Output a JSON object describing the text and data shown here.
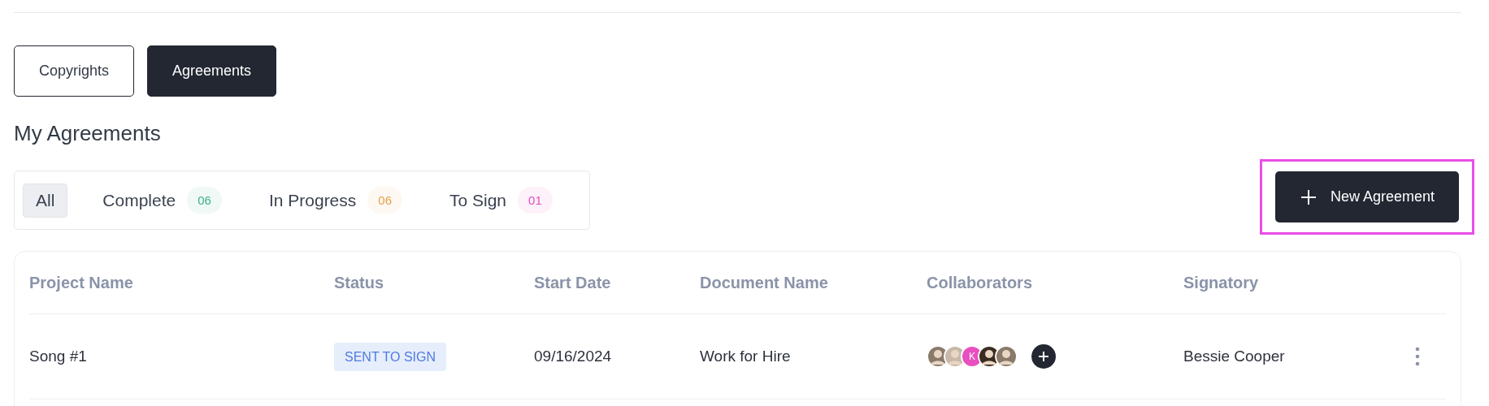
{
  "tabs": [
    {
      "label": "Copyrights",
      "selected": false
    },
    {
      "label": "Agreements",
      "selected": true
    }
  ],
  "section_title": "My Agreements",
  "filters": [
    {
      "label": "All",
      "selected": true
    },
    {
      "label": "Complete",
      "count": "06",
      "color": "#3fae8a",
      "selected": false
    },
    {
      "label": "In Progress",
      "count": "06",
      "color": "#e8a24a",
      "selected": false
    },
    {
      "label": "To Sign",
      "count": "01",
      "color": "#e04fc0",
      "selected": false
    }
  ],
  "new_button": {
    "label": "New Agreement",
    "highlighted": true
  },
  "table": {
    "columns": [
      "Project Name",
      "Status",
      "Start Date",
      "Document Name",
      "Collaborators",
      "Signatory"
    ],
    "rows": [
      {
        "project": "Song #1",
        "status": "SENT TO SIGN",
        "start_date": "09/16/2024",
        "document": "Work for Hire",
        "collaborators": [
          {
            "kind": "photo"
          },
          {
            "kind": "photo"
          },
          {
            "kind": "initials",
            "initials": "K",
            "color": "#e84fbf"
          },
          {
            "kind": "photo"
          },
          {
            "kind": "photo"
          }
        ],
        "signatory": "Bessie Cooper"
      }
    ]
  }
}
